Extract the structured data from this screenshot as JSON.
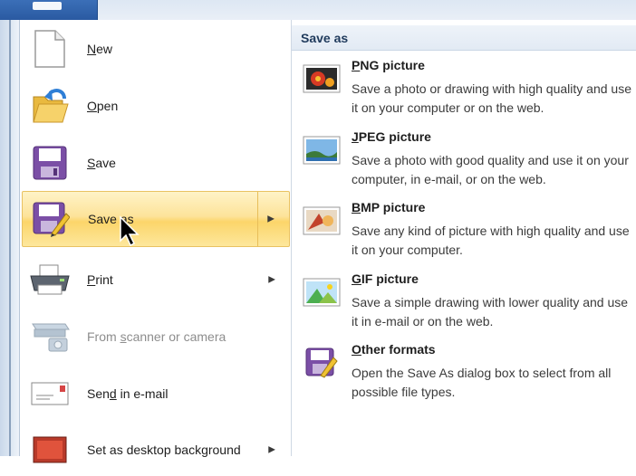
{
  "menu": {
    "items": [
      {
        "label": "New",
        "accel": "N",
        "rest": "ew",
        "icon": "new-document-icon"
      },
      {
        "label": "Open",
        "accel": "O",
        "rest": "pen",
        "icon": "open-folder-icon"
      },
      {
        "label": "Save",
        "accel": "S",
        "rest": "ave",
        "icon": "floppy-disk-icon"
      },
      {
        "label": "Save as",
        "pre": "Save ",
        "accel": "a",
        "rest": "s",
        "icon": "save-as-icon",
        "selected": true
      },
      {
        "label": "Print",
        "accel": "P",
        "rest": "rint",
        "icon": "printer-icon"
      },
      {
        "label": "From scanner or camera",
        "pre": "From ",
        "accel": "s",
        "rest": "canner or camera",
        "icon": "scanner-icon",
        "disabled": true
      },
      {
        "label": "Send in e-mail",
        "pre": "Sen",
        "accel": "d",
        "rest": " in e-mail",
        "icon": "email-icon"
      },
      {
        "label": "Set as desktop background",
        "pre": "Set as desktop background",
        "accel": "",
        "rest": "",
        "icon": "desktop-icon"
      }
    ]
  },
  "submenu": {
    "title": "Save as",
    "items": [
      {
        "accel": "P",
        "rest": "NG picture",
        "desc": "Save a photo or drawing with high quality and use it on your computer or on the web.",
        "icon": "png-picture-icon"
      },
      {
        "accel": "J",
        "rest": "PEG picture",
        "desc": "Save a photo with good quality and use it on your computer, in e-mail, or on the web.",
        "icon": "jpeg-picture-icon"
      },
      {
        "accel": "B",
        "rest": "MP picture",
        "desc": "Save any kind of picture with high quality and use it on your computer.",
        "icon": "bmp-picture-icon"
      },
      {
        "accel": "G",
        "rest": "IF picture",
        "desc": "Save a simple drawing with lower quality and use it in e-mail or on the web.",
        "icon": "gif-picture-icon"
      },
      {
        "accel": "O",
        "rest": "ther formats",
        "desc": "Open the Save As dialog box to select from all possible file types.",
        "icon": "other-formats-icon"
      }
    ]
  },
  "colors": {
    "selected_fill": "#fde39a",
    "selected_border": "#e9c262",
    "header_text": "#1f3a5c",
    "disabled_text": "#8d8d8d"
  }
}
